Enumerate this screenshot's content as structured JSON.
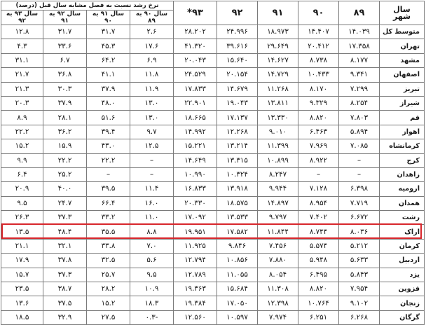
{
  "header": {
    "city_label": "سال\nشهر",
    "years": [
      "۸۹",
      "۹۰",
      "۹۱",
      "۹۲",
      "۹۳*"
    ],
    "growth_title": "نرخ رشد نسبت به فصل مشابه سال قبل (درصد)",
    "growth_cols": [
      [
        "سال ۹۰ به",
        "۸۹"
      ],
      [
        "سال ۹۱ به",
        "۹۰"
      ],
      [
        "سال ۹۲ به",
        "۹۱"
      ],
      [
        "سال ۹۳ به",
        "۹۲"
      ]
    ]
  },
  "rows": [
    {
      "city": "متوسط کل",
      "v": [
        "۱۴.۰۳۹",
        "۱۴.۴۰۷",
        "۱۸.۹۷۳",
        "۲۴.۹۹۶",
        "۲۸.۲۰۲",
        "۲.۶",
        "۳۱.۷",
        "۳۱.۷",
        "۱۲.۸"
      ]
    },
    {
      "city": "تهران",
      "v": [
        "۱۷.۳۵۸",
        "۲۰.۴۱۲",
        "۲۹.۶۴۹",
        "۳۹.۶۱۶",
        "۴۱.۳۲۰",
        "۱۷.۶",
        "۴۵.۳",
        "۳۳.۶",
        "۴.۳"
      ]
    },
    {
      "city": "مشهد",
      "v": [
        "۸.۱۷۷",
        "۸.۷۳۸",
        "۱۴.۶۲۷",
        "۱۵.۶۴۰",
        "۲۰.۰۴۳",
        "۶.۹",
        "۶۴.۲",
        "۶.۷",
        "۳۱.۱"
      ]
    },
    {
      "city": "اصفهان",
      "v": [
        "۹.۳۴۱",
        "۱۰.۴۳۳",
        "۱۴.۷۲۹",
        "۲۰.۱۵۴",
        "۲۴.۵۲۹",
        "۱۱.۸",
        "۴۱.۱",
        "۳۶.۸",
        "۲۱.۷"
      ]
    },
    {
      "city": "تبریز",
      "v": [
        "۷.۲۹۹",
        "۸.۱۷۰",
        "۱۱.۲۶۸",
        "۱۴.۶۷۹",
        "۱۷.۸۳۳",
        "۱۱.۹",
        "۳۷.۹",
        "۳۰.۳",
        "۲۱.۳"
      ]
    },
    {
      "city": "شیراز",
      "v": [
        "۸.۲۵۴",
        "۹.۳۲۹",
        "۱۳.۸۱۱",
        "۱۹.۰۴۳",
        "۲۲.۹۰۱",
        "۱۳.۰",
        "۴۸.۰",
        "۳۷.۹",
        "۲۰.۳"
      ]
    },
    {
      "city": "قم",
      "v": [
        "۷.۸۰۳",
        "۸.۸۲۰",
        "۱۳.۳۳۰",
        "۱۷.۱۳۷",
        "۱۸.۶۶۵",
        "۱۳.۰",
        "۵۱.۶",
        "۲۸.۱",
        "۸.۹"
      ]
    },
    {
      "city": "اهواز",
      "v": [
        "۵.۸۹۴",
        "۶.۴۶۳",
        "۹.۰۱۰",
        "۱۲.۲۶۸",
        "۱۴.۹۹۲",
        "۹.۷",
        "۳۹.۴",
        "۳۶.۲",
        "۲۲.۲"
      ]
    },
    {
      "city": "کرمانشاه",
      "v": [
        "۷.۰۸۵",
        "۷.۹۶۹",
        "۱۱.۳۹۹",
        "۱۳.۲۱۴",
        "۱۵.۲۲۱",
        "۱۲.۵",
        "۴۳.۰",
        "۱۵.۹",
        "۱۵.۲"
      ]
    },
    {
      "city": "کرج",
      "v": [
        "–",
        "۸.۹۲۲",
        "۱۰.۸۹۹",
        "۱۳.۳۱۵",
        "۱۴.۶۴۹",
        "–",
        "۲۲.۲",
        "۲۲.۲",
        "۹.۹"
      ]
    },
    {
      "city": "زاهدان",
      "v": [
        "–",
        "–",
        "۸.۲۴۷",
        "۱۰.۳۲۴",
        "۱۰.۹۹۰",
        "–",
        "–",
        "۲۵.۲",
        "۶.۴"
      ]
    },
    {
      "city": "ارومیه",
      "v": [
        "۶.۳۹۸",
        "۷.۱۲۸",
        "۹.۹۴۴",
        "۱۳.۹۱۸",
        "۱۶.۸۳۳",
        "۱۱.۴",
        "۳۹.۵",
        "۴۰.۰",
        "۲۰.۹"
      ]
    },
    {
      "city": "همدان",
      "v": [
        "۷.۷۱۹",
        "۸.۹۵۴",
        "۱۴.۸۹۷",
        "۱۸.۵۷۵",
        "۲۰.۳۳۰",
        "۱۶.۰",
        "۶۶.۴",
        "۲۴.۷",
        "۹.۵"
      ]
    },
    {
      "city": "رشت",
      "v": [
        "۶.۶۷۲",
        "۷.۴۰۲",
        "۹.۷۹۷",
        "۱۳.۵۳۳",
        "۱۷.۰۹۲",
        "۱۱.۰",
        "۳۳.۲",
        "۳۷.۳",
        "۲۶.۳"
      ]
    },
    {
      "city": "اراک",
      "v": [
        "۸.۰۳۶",
        "۸.۷۴۴",
        "۱۱.۸۴۴",
        "۱۷.۵۸۲",
        "۱۹.۹۵۱",
        "۸.۸",
        "۳۵.۵",
        "۴۸.۴",
        "۱۳.۵"
      ]
    },
    {
      "city": "کرمان",
      "v": [
        "۵.۲۱۲",
        "۵.۵۷۴",
        "۷.۴۵۶",
        "۹.۸۴۶",
        "۱۱.۹۲۵",
        "۷.۰",
        "۳۳.۸",
        "۳۲.۱",
        "۲۱.۱"
      ]
    },
    {
      "city": "اردبیل",
      "v": [
        "۵.۶۳۳",
        "۵.۹۴۸",
        "۷.۸۸۰",
        "۱۰.۸۵۶",
        "۱۲.۷۹۴",
        "۵.۶",
        "۳۲.۵",
        "۳۷.۸",
        "۱۷.۹"
      ]
    },
    {
      "city": "یزد",
      "v": [
        "۵.۸۴۳",
        "۶.۴۹۵",
        "۸.۰۵۴",
        "۱۱.۰۵۵",
        "۱۲.۷۸۹",
        "۹.۵",
        "۲۵.۷",
        "۳۷.۳",
        "۱۵.۷"
      ]
    },
    {
      "city": "قزوین",
      "v": [
        "۷.۹۵۴",
        "۸.۸۲۰",
        "۱۱.۳۰۸",
        "۱۵.۶۸۴",
        "۱۹.۳۶۳",
        "۱۰.۹",
        "۲۸.۲",
        "۳۸.۷",
        "۲۳.۵"
      ]
    },
    {
      "city": "زنجان",
      "v": [
        "۹.۱۰۲",
        "۱۰.۷۶۴",
        "۱۲.۳۹۸",
        "۱۷.۰۵۰",
        "۱۹.۳۸۴",
        "۱۸.۳",
        "۱۵.۲",
        "۳۷.۵",
        "۱۳.۶"
      ]
    },
    {
      "city": "گرگان",
      "v": [
        "۶.۲۶۸",
        "۶.۲۵۱",
        "۷.۹۷۴",
        "۱۰.۵۹۷",
        "۱۲.۵۶۰",
        "-۰.۳",
        "۲۷.۵",
        "۳۲.۹",
        "۱۸.۵"
      ]
    }
  ],
  "highlight_row": "اراک",
  "highlight_color": "#d8262b"
}
